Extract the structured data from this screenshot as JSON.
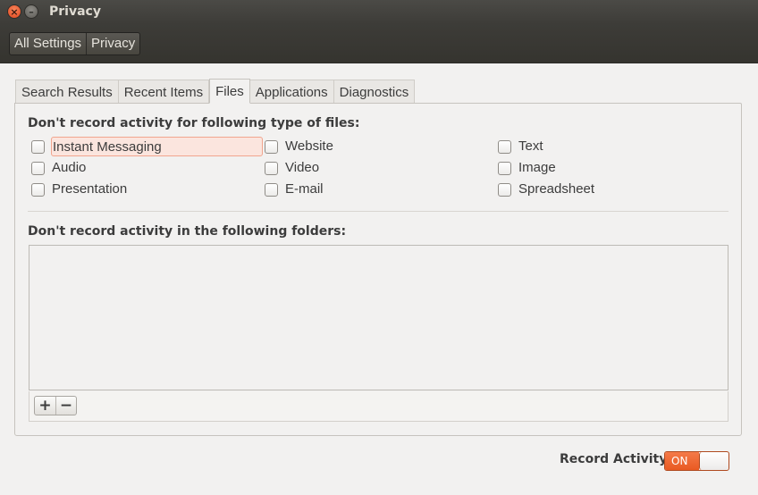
{
  "window": {
    "title": "Privacy",
    "close_glyph": "×",
    "minimize_glyph": "–"
  },
  "breadcrumb": [
    "All Settings",
    "Privacy"
  ],
  "tabs": [
    {
      "label": "Search Results"
    },
    {
      "label": "Recent Items"
    },
    {
      "label": "Files",
      "active": true
    },
    {
      "label": "Applications"
    },
    {
      "label": "Diagnostics"
    }
  ],
  "files": {
    "types_heading": "Don't record activity for following type of files:",
    "file_types": [
      {
        "label": "Instant Messaging",
        "checked": false,
        "focused": true
      },
      {
        "label": "Website",
        "checked": false
      },
      {
        "label": "Text",
        "checked": false
      },
      {
        "label": "Audio",
        "checked": false
      },
      {
        "label": "Video",
        "checked": false
      },
      {
        "label": "Image",
        "checked": false
      },
      {
        "label": "Presentation",
        "checked": false
      },
      {
        "label": "E-mail",
        "checked": false
      },
      {
        "label": "Spreadsheet",
        "checked": false
      }
    ],
    "folders_heading": "Don't record activity in the following folders:",
    "add_glyph": "+",
    "remove_glyph": "−"
  },
  "record_activity": {
    "label": "Record Activity",
    "state_label": "ON",
    "on": true
  },
  "colors": {
    "accent": "#e95a22",
    "focus_fill": "#fbe5de",
    "titlebar": "#3d3c38"
  }
}
